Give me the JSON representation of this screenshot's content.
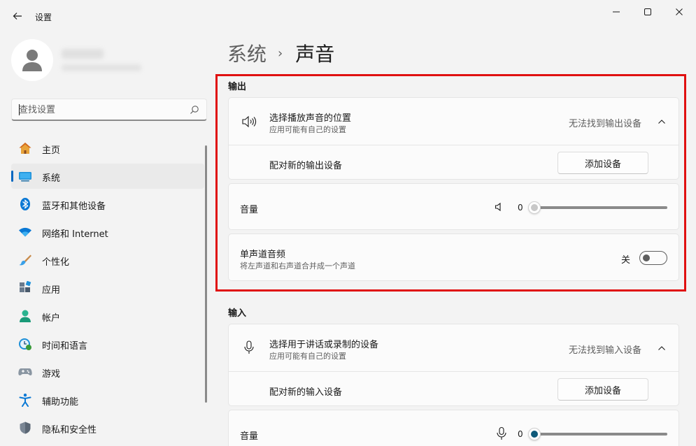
{
  "window": {
    "title": "设置",
    "controls": [
      "minimize-icon",
      "maximize-icon",
      "close-icon"
    ]
  },
  "search": {
    "placeholder": "查找设置"
  },
  "sidebar": {
    "items": [
      {
        "label": "主页",
        "icon": "home-icon",
        "active": false
      },
      {
        "label": "系统",
        "icon": "system-icon",
        "active": true
      },
      {
        "label": "蓝牙和其他设备",
        "icon": "bluetooth-icon",
        "active": false
      },
      {
        "label": "网络和 Internet",
        "icon": "wifi-icon",
        "active": false
      },
      {
        "label": "个性化",
        "icon": "brush-icon",
        "active": false
      },
      {
        "label": "应用",
        "icon": "apps-icon",
        "active": false
      },
      {
        "label": "帐户",
        "icon": "account-icon",
        "active": false
      },
      {
        "label": "时间和语言",
        "icon": "clock-globe-icon",
        "active": false
      },
      {
        "label": "游戏",
        "icon": "gamepad-icon",
        "active": false
      },
      {
        "label": "辅助功能",
        "icon": "accessibility-icon",
        "active": false
      },
      {
        "label": "隐私和安全性",
        "icon": "shield-icon",
        "active": false
      }
    ]
  },
  "breadcrumb": {
    "parent": "系统",
    "separator": "›",
    "current": "声音"
  },
  "output": {
    "section_title": "输出",
    "device_title": "选择播放声音的位置",
    "device_subtitle": "应用可能有自己的设置",
    "device_status": "无法找到输出设备",
    "pair_label": "配对新的输出设备",
    "add_button": "添加设备",
    "volume_label": "音量",
    "volume_value": "0",
    "mono_title": "单声道音频",
    "mono_subtitle": "将左声道和右声道合并成一个声道",
    "mono_state": "关"
  },
  "input": {
    "section_title": "输入",
    "device_title": "选择用于讲话或录制的设备",
    "device_subtitle": "应用可能有自己的设置",
    "device_status": "无法找到输入设备",
    "pair_label": "配对新的输入设备",
    "add_button": "添加设备",
    "volume_label": "音量",
    "volume_value": "0"
  },
  "colors": {
    "accent": "#0067c0",
    "highlight": "#e01010"
  }
}
